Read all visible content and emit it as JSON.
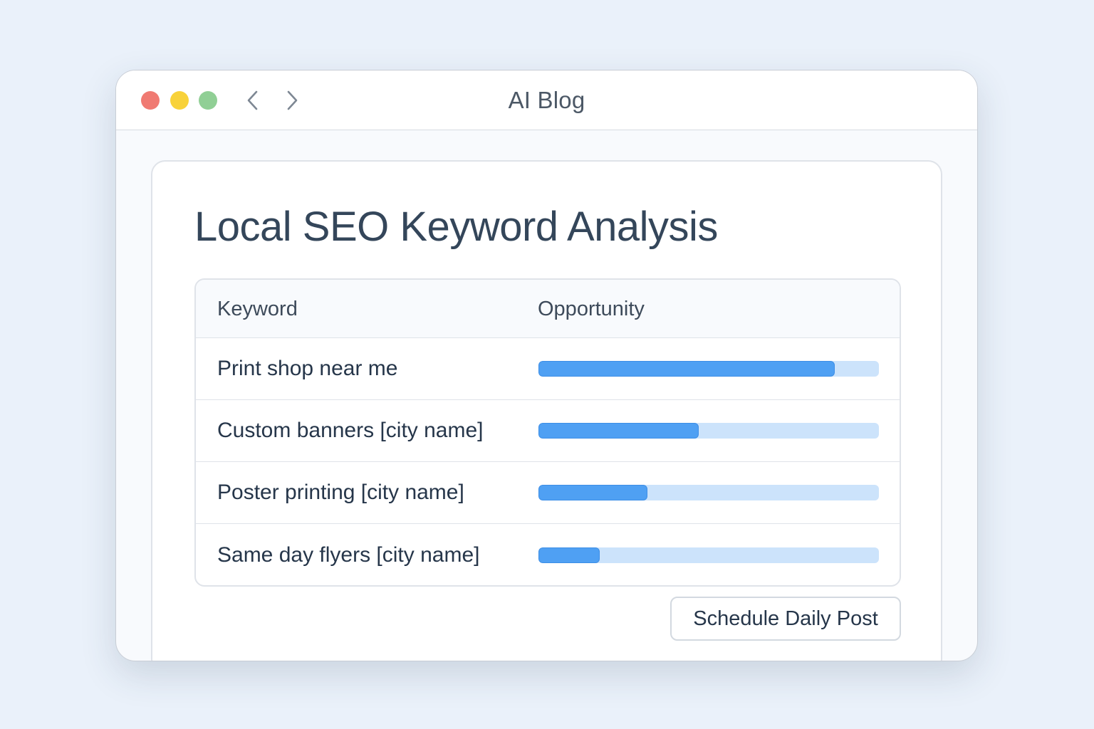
{
  "window": {
    "title": "AI Blog"
  },
  "page": {
    "title": "Local SEO Keyword Analysis"
  },
  "table": {
    "headers": {
      "keyword": "Keyword",
      "opportunity": "Opportunity"
    },
    "rows": [
      {
        "keyword": "Print shop near me",
        "opportunity": 0.87
      },
      {
        "keyword": "Custom banners [city name]",
        "opportunity": 0.47
      },
      {
        "keyword": "Poster printing [city name]",
        "opportunity": 0.32
      },
      {
        "keyword": "Same day flyers [city name]",
        "opportunity": 0.18
      }
    ]
  },
  "actions": {
    "schedule_label": "Schedule Daily Post"
  },
  "colors": {
    "bar_fill": "#4fa0f3",
    "bar_track": "#cce3fb",
    "close": "#f07a72",
    "minimize": "#f8d23a",
    "maximize": "#90cf95"
  },
  "icons": {
    "back": "chevron-left-icon",
    "forward": "chevron-right-icon"
  }
}
